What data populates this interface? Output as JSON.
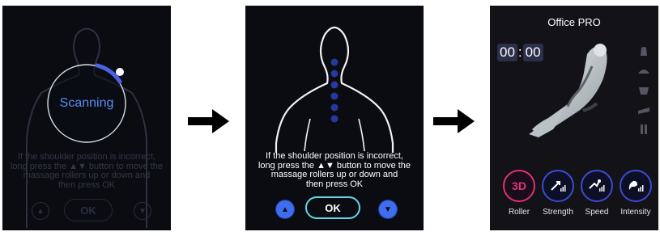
{
  "panel1": {
    "status": "Scanning",
    "instruction": [
      "If the shoulder position is incorrect,",
      "long press the ▲▼ button to move the",
      "massage rollers up or down and",
      "then press OK"
    ],
    "up_glyph": "▲",
    "ok_label": "OK",
    "down_glyph": "▼"
  },
  "panel2": {
    "instruction": [
      "If the shoulder position is incorrect,",
      "long press the ▲▼ button to move the",
      "massage rollers up or down and",
      "then press OK"
    ],
    "up_glyph": "▲",
    "ok_label": "OK",
    "down_glyph": "▼"
  },
  "panel3": {
    "title": "Office PRO",
    "timer": {
      "minutes": "00",
      "separator": ":",
      "seconds": "00"
    },
    "modes": [
      {
        "badge": "3D",
        "label": "Roller",
        "icon": "3d-roller-icon"
      },
      {
        "badge": "",
        "label": "Strength",
        "icon": "strength-icon"
      },
      {
        "badge": "",
        "label": "Speed",
        "icon": "speed-icon"
      },
      {
        "badge": "",
        "label": "Intensity",
        "icon": "intensity-icon"
      }
    ]
  },
  "colors": {
    "accent_blue": "#3f6df0",
    "ok_cyan": "#5fd8e8",
    "roller_pink": "#e0307a",
    "dot_blue": "#27399b"
  }
}
